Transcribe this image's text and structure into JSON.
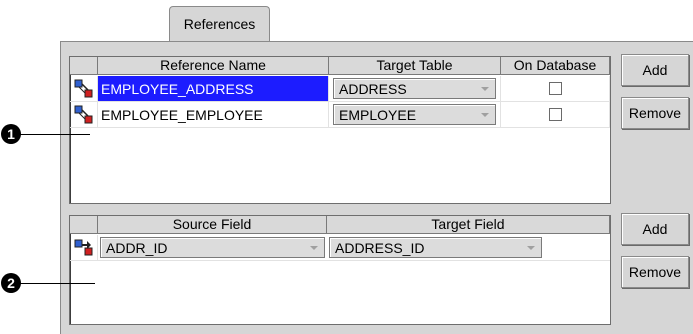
{
  "tab": {
    "label": "References"
  },
  "references_table": {
    "headers": [
      "Reference Name",
      "Target Table",
      "On Database"
    ],
    "rows": [
      {
        "name": "EMPLOYEE_ADDRESS",
        "target": "ADDRESS",
        "on_database": false,
        "selected": true
      },
      {
        "name": "EMPLOYEE_EMPLOYEE",
        "target": "EMPLOYEE",
        "on_database": false,
        "selected": false
      }
    ],
    "add_label": "Add",
    "remove_label": "Remove"
  },
  "fields_table": {
    "headers": [
      "Source Field",
      "Target Field"
    ],
    "rows": [
      {
        "source": "ADDR_ID",
        "target": "ADDRESS_ID"
      }
    ],
    "add_label": "Add",
    "remove_label": "Remove"
  },
  "callouts": [
    "1",
    "2"
  ],
  "colors": {
    "selection": "#1c1cff",
    "panel": "#d6d6d6"
  }
}
